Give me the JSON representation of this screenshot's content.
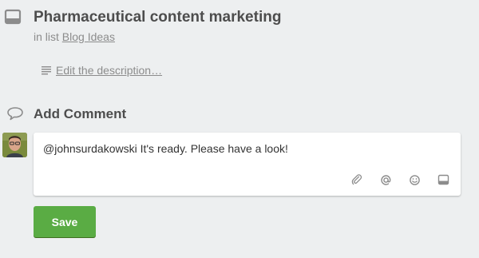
{
  "card": {
    "title": "Pharmaceutical content marketing",
    "in_list_prefix": "in list",
    "list_name": "Blog Ideas",
    "icon": "card-icon"
  },
  "description": {
    "placeholder": "Edit the description…",
    "icon": "description-lines-icon"
  },
  "comment": {
    "heading": "Add Comment",
    "heading_icon": "comment-bubble-icon",
    "text": "@johnsurdakowski It's ready. Please have a look!",
    "actions": [
      "attach-icon",
      "mention-icon",
      "emoji-icon",
      "card-icon"
    ]
  },
  "save_button": {
    "label": "Save"
  },
  "colors": {
    "background": "#edeff0",
    "title": "#4d4d4d",
    "muted": "#8c8c8c",
    "save": "#5aac44"
  }
}
